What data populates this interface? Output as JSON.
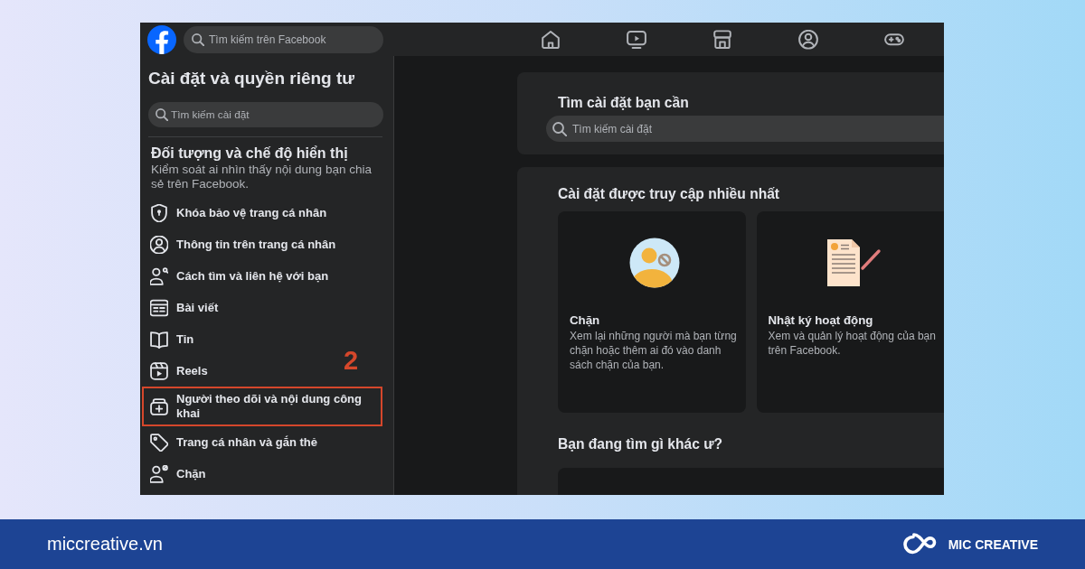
{
  "top_bar": {
    "search": {
      "placeholder": "Tìm kiếm trên Facebook"
    }
  },
  "sidebar": {
    "title": "Cài đặt và quyền riêng tư",
    "search": {
      "placeholder": "Tìm kiếm cài đặt"
    },
    "section": {
      "title": "Đối tượng và chế độ hiển thị",
      "description": "Kiểm soát ai nhìn thấy nội dung bạn chia sẻ trên Facebook."
    },
    "items": [
      {
        "label": "Khóa bảo vệ trang cá nhân",
        "annotated": false
      },
      {
        "label": "Thông tin trên trang cá nhân",
        "annotated": false
      },
      {
        "label": "Cách tìm và liên hệ với bạn",
        "annotated": false
      },
      {
        "label": "Bài viết",
        "annotated": false
      },
      {
        "label": "Tin",
        "annotated": false
      },
      {
        "label": "Reels",
        "annotated": false
      },
      {
        "label": "Người theo dõi và nội dung công khai",
        "annotated": true
      },
      {
        "label": "Trang cá nhân và gắn thẻ",
        "annotated": false
      },
      {
        "label": "Chặn",
        "annotated": false
      }
    ],
    "annotation": {
      "label": "2"
    }
  },
  "main": {
    "search_card": {
      "title": "Tìm cài đặt bạn cần",
      "search": {
        "placeholder": "Tìm kiếm cài đặt"
      }
    },
    "most_visited": {
      "title": "Cài đặt được truy cập nhiều nhất",
      "tiles": [
        {
          "title": "Chặn",
          "description": "Xem lại những người mà bạn từng chặn hoặc thêm ai đó vào danh sách chặn của bạn."
        },
        {
          "title": "Nhật ký hoạt động",
          "description": "Xem và quản lý hoạt động của bạn trên Facebook."
        }
      ]
    },
    "more": {
      "title": "Bạn đang tìm gì khác ư?"
    }
  },
  "footer": {
    "site": "miccreative.vn",
    "brand": "MIC CREATIVE"
  }
}
